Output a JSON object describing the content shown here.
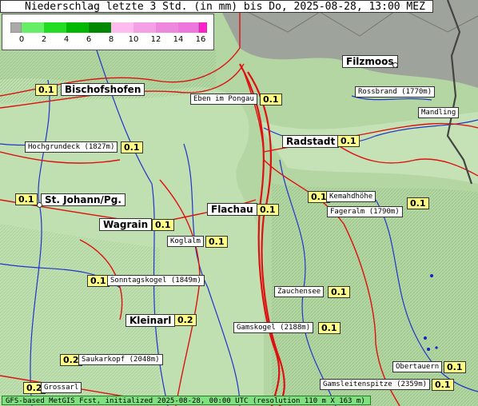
{
  "title": "Niederschlag letzte 3 Std. (in mm) bis Do, 2025-08-28, 13:00 MEZ",
  "legend": {
    "ticks": [
      "0",
      "2",
      "4",
      "6",
      "8",
      "10",
      "12",
      "14",
      "16"
    ],
    "colors": {
      "low": "#aaaaaa",
      "green_light": "#66ee66",
      "green": "#00c000",
      "green_dark": "#008800",
      "pink_light": "#ffbbee",
      "pink": "#ee88dd",
      "magenta": "#ff33cc"
    }
  },
  "places": [
    {
      "name": "Filzmoos"
    },
    {
      "name": "Bischofshofen",
      "value": "0.1"
    },
    {
      "name": "Radstadt",
      "value": "0.1"
    },
    {
      "name": "St. Johann/Pg.",
      "value": "0.1"
    },
    {
      "name": "Flachau",
      "value": "0.1"
    },
    {
      "name": "Wagrain",
      "value": "0.1"
    },
    {
      "name": "Kleinarl",
      "value": "0.2"
    }
  ],
  "peaks": [
    {
      "name": "Eben im Pongau",
      "value": "0.1"
    },
    {
      "name": "Rossbrand (1770m)"
    },
    {
      "name": "Mandling"
    },
    {
      "name": "Hochgrundeck (1827m)",
      "value": "0.1"
    },
    {
      "name": "Kemahdhöhe",
      "value": "0.1"
    },
    {
      "name": "Fageralm (1790m)",
      "value": "0.1"
    },
    {
      "name": "Koglalm",
      "value": "0.1"
    },
    {
      "name": "Sonntagskogel (1849m)",
      "value": "0.1"
    },
    {
      "name": "Zauchensee",
      "value": "0.1"
    },
    {
      "name": "Gamskogel (2188m)",
      "value": "0.1"
    },
    {
      "name": "Saukarkopf (2048m)",
      "value": "0.2"
    },
    {
      "name": "Obertauern",
      "value": "0.1"
    },
    {
      "name": "Grossarl",
      "value": "0.2"
    },
    {
      "name": "Gamsleitenspitze (2359m)",
      "value": "0.1"
    }
  ],
  "footer": "GFS-based MetGIS Fcst, initialized 2025-08-28, 00:00 UTC (resolution 110 m X 163 m)"
}
